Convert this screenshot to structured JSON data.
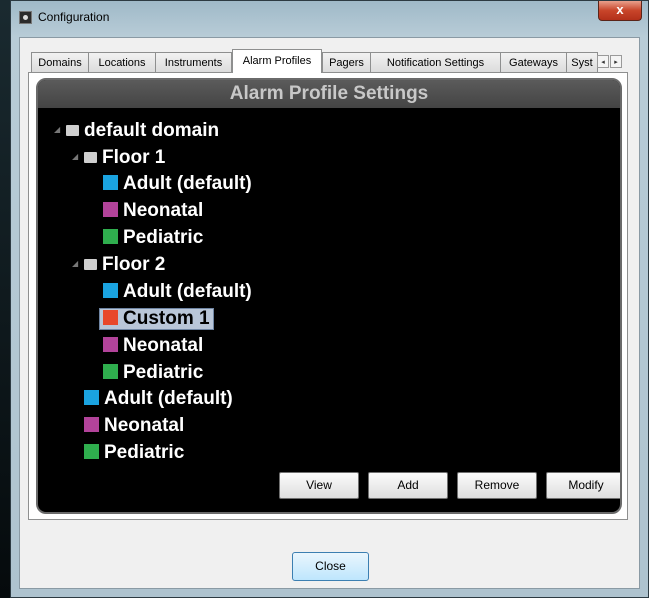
{
  "window": {
    "title": "Configuration",
    "close_label": "x"
  },
  "tabs": [
    {
      "label": "Domains",
      "active": false
    },
    {
      "label": "Locations",
      "active": false
    },
    {
      "label": "Instruments",
      "active": false
    },
    {
      "label": "Alarm Profiles",
      "active": true
    },
    {
      "label": "Pagers",
      "active": false
    },
    {
      "label": "Notification Settings",
      "active": false
    },
    {
      "label": "Gateways",
      "active": false
    },
    {
      "label": "Syst",
      "active": false
    }
  ],
  "tab_scroll": {
    "left": "◂",
    "right": "▸"
  },
  "panel": {
    "header": "Alarm Profile Settings"
  },
  "colors": {
    "adult": "#1aa3e0",
    "neonatal": "#b2439a",
    "pediatric": "#2fae4e",
    "custom": "#e8482b"
  },
  "tree": {
    "root": "default domain",
    "floor1": {
      "label": "Floor 1",
      "items": [
        "Adult (default)",
        "Neonatal",
        "Pediatric"
      ]
    },
    "floor2": {
      "label": "Floor 2",
      "items": [
        "Adult (default)",
        "Custom 1",
        "Neonatal",
        "Pediatric"
      ],
      "selected": "Custom 1"
    },
    "domain_items": [
      "Adult (default)",
      "Neonatal",
      "Pediatric"
    ]
  },
  "buttons": {
    "view": "View",
    "add": "Add",
    "remove": "Remove",
    "modify": "Modify",
    "close": "Close"
  }
}
